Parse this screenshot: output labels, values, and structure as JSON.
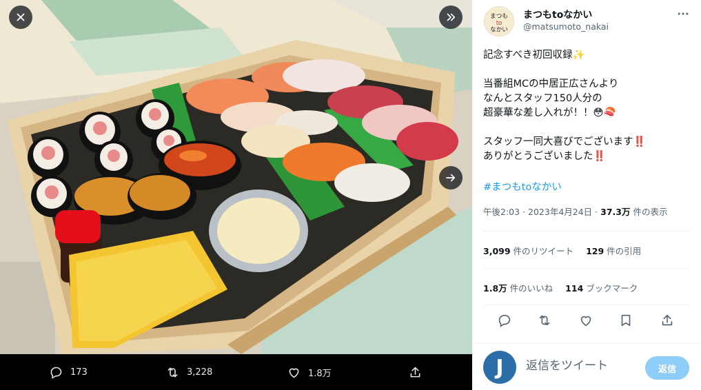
{
  "media": {
    "actions": {
      "reply_count": "173",
      "retweet_count": "3,228",
      "like_count": "1.8万"
    }
  },
  "author": {
    "name": "まつもtoなかい",
    "handle": "@matsumoto_nakai",
    "avatar_text": "まつもtoなかい"
  },
  "tweet": {
    "text": "記念すべき初回収録✨\n\n当番組MCの中居正広さんより\nなんとスタッフ150人分の\n超豪華な差し入れが！！😳🍣\n\nスタッフ一同大喜びでございます‼️\nありがとうございました‼️",
    "hashtag": "#まつもtoなかい",
    "time": "午後2:03",
    "date": "2023年4月24日",
    "views_count": "37.3万",
    "views_label": "件の表示"
  },
  "stats": {
    "retweets_count": "3,099",
    "retweets_label": "件のリツイート",
    "quotes_count": "129",
    "quotes_label": "件の引用",
    "likes_count": "1.8万",
    "likes_label": "件のいいね",
    "bookmarks_count": "114",
    "bookmarks_label": "ブックマーク"
  },
  "reply": {
    "avatar_letter": "J",
    "placeholder": "返信をツイート",
    "button_label": "返信"
  },
  "colors": {
    "accent": "#1d9bf0",
    "reply_button": "#8ecdf8",
    "text_secondary": "#536471"
  }
}
